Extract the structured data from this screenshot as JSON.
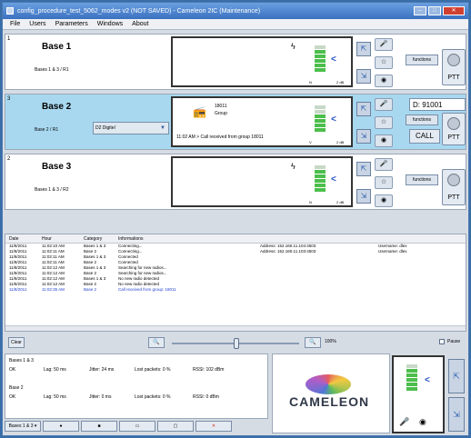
{
  "window": {
    "title": "config_procedure_test_5062_modes v2 (NOT SAVED) - Cameleon 2IC (Maintenance)"
  },
  "menu": [
    "File",
    "Users",
    "Parameters",
    "Windows",
    "About"
  ],
  "bases": [
    {
      "index": "1",
      "name": "Base 1",
      "subtitle": "Bases 1 & 3 / R1",
      "n_label": "N",
      "n_value": "2 dB",
      "functions_label": "functions",
      "ptt_label": "PTT"
    },
    {
      "index": "3",
      "name": "Base 2",
      "subtitle": "Base 2 / R1",
      "dropdown": "D2 Digitel",
      "group_number": "18011",
      "group_label": "Group",
      "call_message": "11:02 AM > Call received from group 18011",
      "n_label": "V",
      "n_value": "2 dB",
      "id_select": "D: 91001",
      "functions_label": "functions",
      "call_label": "CALL",
      "ptt_label": "PTT"
    },
    {
      "index": "2",
      "name": "Base 3",
      "subtitle": "Bases 1 & 3 / R2",
      "n_label": "N",
      "n_value": "2 dB",
      "functions_label": "functions",
      "ptt_label": "PTT"
    }
  ],
  "log": {
    "headers": {
      "date": "Date",
      "hour": "Hour",
      "category": "Category",
      "info": "Informations"
    },
    "rows": [
      {
        "date": "11/8/2011",
        "hour": "11:02:10 AM",
        "category": "Bases 1 & 3",
        "info": "Connecting...",
        "address": "Address: 152.160.11.104:4503",
        "user": "Username: dlex",
        "blue": false
      },
      {
        "date": "11/8/2011",
        "hour": "11:02:11 AM",
        "category": "Base 2",
        "info": "Connecting...",
        "address": "Address: 152.160.11.103:4503",
        "user": "Username: dlex",
        "blue": false
      },
      {
        "date": "11/8/2011",
        "hour": "11:02:11 AM",
        "category": "Bases 1 & 3",
        "info": "Connected",
        "address": "",
        "user": "",
        "blue": false
      },
      {
        "date": "11/8/2011",
        "hour": "11:02:11 AM",
        "category": "Base 2",
        "info": "Connected",
        "address": "",
        "user": "",
        "blue": false
      },
      {
        "date": "11/8/2011",
        "hour": "11:02:12 AM",
        "category": "Bases 1 & 3",
        "info": "Searching for new radios...",
        "address": "",
        "user": "",
        "blue": false
      },
      {
        "date": "11/8/2011",
        "hour": "11:02:12 AM",
        "category": "Base 2",
        "info": "Searching for new radios...",
        "address": "",
        "user": "",
        "blue": false
      },
      {
        "date": "11/8/2011",
        "hour": "11:02:12 AM",
        "category": "Bases 1 & 3",
        "info": "No new radio detected",
        "address": "",
        "user": "",
        "blue": false
      },
      {
        "date": "11/8/2011",
        "hour": "11:02:12 AM",
        "category": "Base 2",
        "info": "No new radio detected",
        "address": "",
        "user": "",
        "blue": false
      },
      {
        "date": "11/8/2011",
        "hour": "11:02:35 AM",
        "category": "Base 2",
        "info": "Call received from group: 18011",
        "address": "",
        "user": "",
        "blue": true
      }
    ]
  },
  "controls": {
    "clear": "Clear",
    "zoom": "100%",
    "pause": "Pause",
    "slider_value": 0.5
  },
  "stats": {
    "groups": [
      {
        "name": "Bases 1 & 3",
        "status": "OK",
        "lag": "Lag: 50 ms",
        "jitter": "Jitter: 24 ms",
        "lost": "Lost packets: 0 %",
        "rssi": "RSSI: 102 dBm"
      },
      {
        "name": "Base 2",
        "status": "OK",
        "lag": "Lag: 50 ms",
        "jitter": "Jitter: 0 ms",
        "lost": "Lost packets: 0 %",
        "rssi": "RSSI: 0 dBm"
      }
    ]
  },
  "bottom_select": "Bases 1 & 3",
  "logo": "CAMELEON"
}
